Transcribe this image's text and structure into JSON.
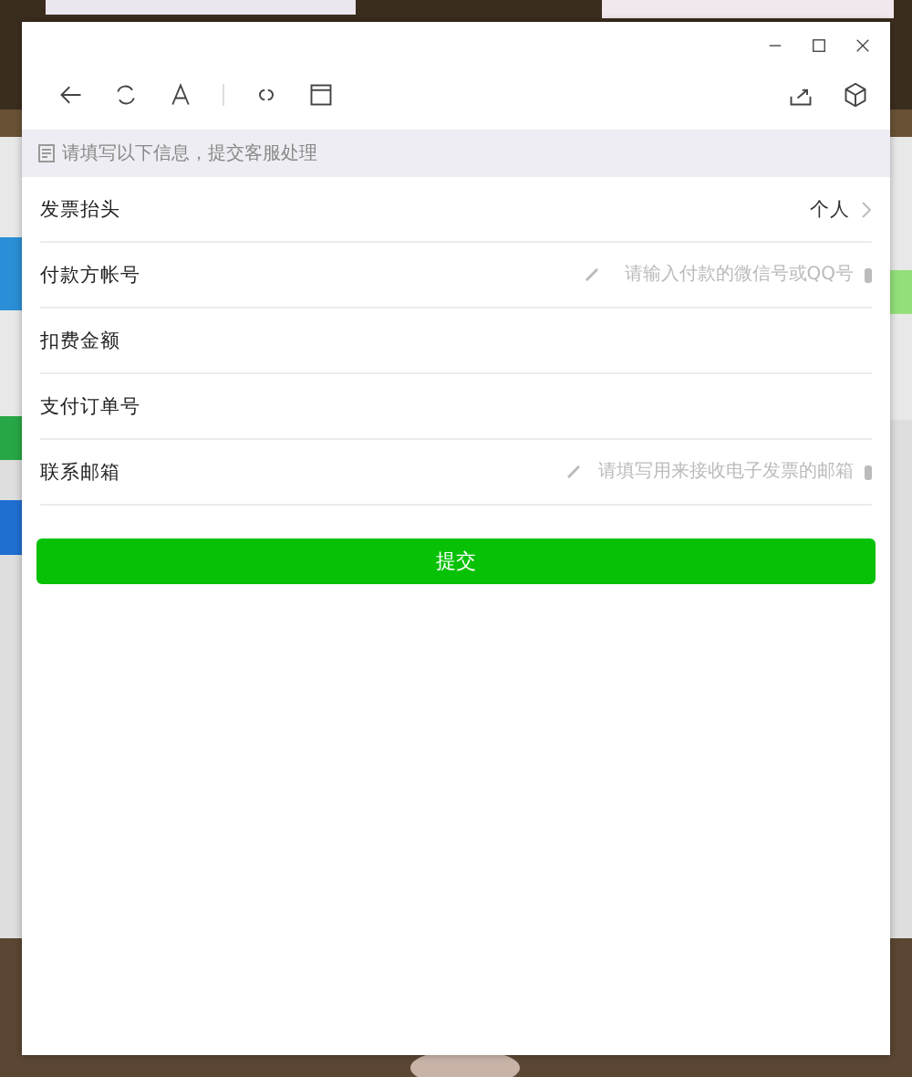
{
  "notice": {
    "text": "请填写以下信息，提交客服处理"
  },
  "rows": [
    {
      "kind": "select",
      "label": "发票抬头",
      "value": "个人"
    },
    {
      "kind": "input",
      "label": "付款方帐号",
      "placeholder": "请输入付款的微信号或QQ号"
    },
    {
      "kind": "plain",
      "label": "扣费金额"
    },
    {
      "kind": "plain",
      "label": "支付订单号"
    },
    {
      "kind": "input",
      "label": "联系邮箱",
      "placeholder": "请填写用来接收电子发票的邮箱"
    }
  ],
  "submit": {
    "label": "提交"
  }
}
